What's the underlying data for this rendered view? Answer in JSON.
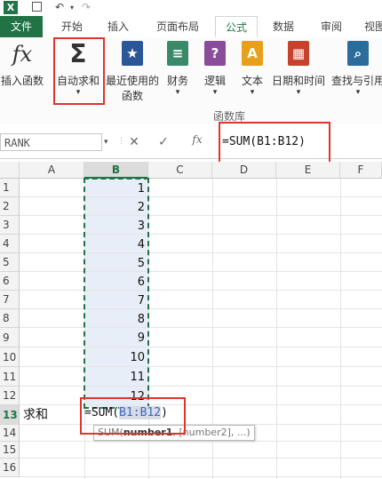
{
  "quick_access": {
    "undo_icon": "↶",
    "redo_icon": "↷"
  },
  "tabs": [
    {
      "label": "文件"
    },
    {
      "label": "开始"
    },
    {
      "label": "插入"
    },
    {
      "label": "页面布局"
    },
    {
      "label": "公式"
    },
    {
      "label": "数据"
    },
    {
      "label": "审阅"
    },
    {
      "label": "视图"
    }
  ],
  "ribbon": {
    "insert_function": {
      "icon": "fx",
      "label": "插入函数"
    },
    "autosum": {
      "icon": "Σ",
      "label": "自动求和",
      "arrow": "▾"
    },
    "recent": {
      "label": "最近使用的",
      "label2": "函数",
      "arrow": "▾"
    },
    "financial": {
      "label": "财务",
      "arrow": "▾"
    },
    "logical": {
      "label": "逻辑",
      "arrow": "▾"
    },
    "text": {
      "label": "文本",
      "arrow": "▾"
    },
    "datetime": {
      "label": "日期和时间",
      "arrow": "▾"
    },
    "lookup": {
      "label": "查找与引用",
      "arrow": "▾"
    },
    "group_label": "函数库"
  },
  "formula_bar": {
    "name_box": "RANK",
    "cancel": "✕",
    "enter": "✓",
    "fx": "fx",
    "formula": "=SUM(B1:B12)"
  },
  "grid": {
    "columns": [
      "A",
      "B",
      "C",
      "D",
      "E",
      "F"
    ],
    "rows": [
      "1",
      "2",
      "3",
      "4",
      "5",
      "6",
      "7",
      "8",
      "9",
      "10",
      "11",
      "12",
      "13",
      "14",
      "15",
      "16"
    ],
    "b_values": [
      "1",
      "2",
      "3",
      "4",
      "5",
      "6",
      "7",
      "8",
      "9",
      "10",
      "11",
      "12"
    ],
    "a13": "求和",
    "b13_prefix": "=SUM(",
    "b13_ref": "B1:B12",
    "b13_suffix": ")",
    "tooltip": {
      "fn": "SUM(",
      "arg1": "number1",
      "rest": ", [number2], ...)"
    }
  }
}
